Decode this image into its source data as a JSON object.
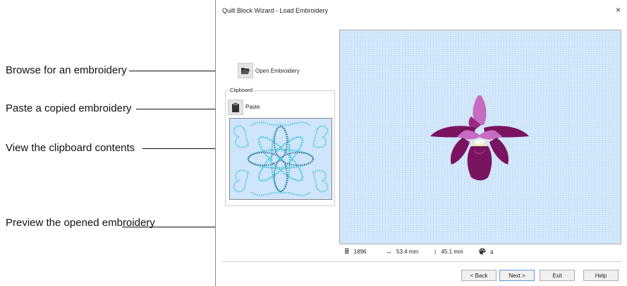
{
  "callouts": {
    "browse": "Browse for an embroidery",
    "paste": "Paste a copied embroidery",
    "view": "View the clipboard contents",
    "preview": "Preview the opened embroidery"
  },
  "dialog": {
    "title": "Quilt Block Wizard - Load Embroidery",
    "close": "×",
    "open_label": "Open Embroidery",
    "clipboard_group": "Clipboard",
    "paste_label": "Paste",
    "status": {
      "stitches": "1896",
      "width": "53.4 mm",
      "height": "45.1 mm",
      "colors": "4"
    },
    "buttons": {
      "back": "< Back",
      "next": "Next >",
      "exit": "Exit",
      "help": "Help"
    }
  },
  "colors": {
    "preview_bg": "#cfe6fb",
    "flower_dark": "#7a1460",
    "flower_mid": "#9a2a80",
    "flower_light": "#c76cc0",
    "clip_pattern": "#4bc7d9",
    "clip_dark": "#3a4a7a"
  },
  "icons": {
    "open": "folder-open-icon",
    "paste": "clipboard-icon",
    "stitches": "stitch-count-icon",
    "width": "horizontal-arrows-icon",
    "height": "vertical-arrows-icon",
    "colors": "palette-icon"
  }
}
